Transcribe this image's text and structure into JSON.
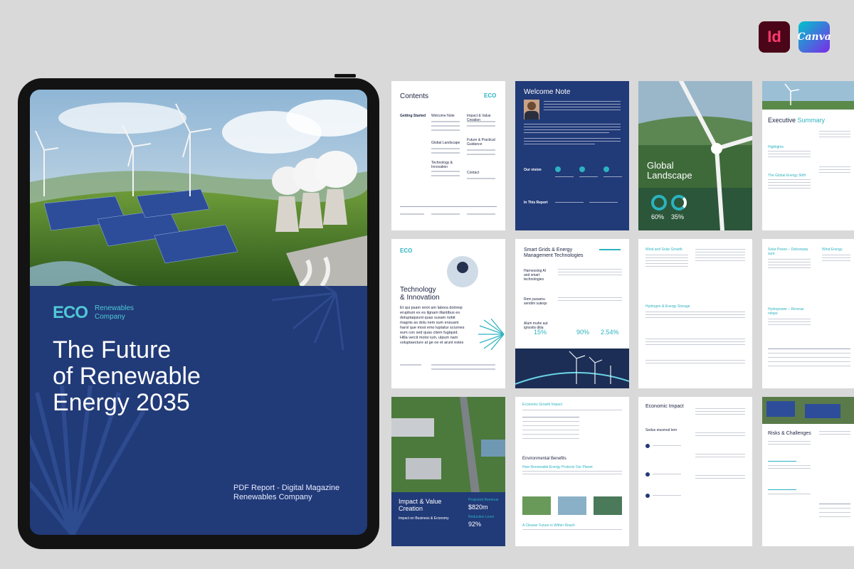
{
  "badges": {
    "indesign": "Id",
    "canva": "Canva"
  },
  "cover": {
    "logo_mark": "ECO",
    "logo_line1": "Renewables",
    "logo_line2": "Company",
    "title_line1": "The Future",
    "title_line2": "of Renewable",
    "title_line3": "Energy 2035",
    "subtitle_line1": "PDF Report - Digital Magazine",
    "subtitle_line2": "Renewables Company"
  },
  "pages": {
    "contents": {
      "title": "Contents",
      "logo": "ECO",
      "sections": [
        "Getting Started",
        "Welcome Note",
        "Global Landscape",
        "Technology & Innovation",
        "Impact & Value Creation",
        "Future & Practical Guidance",
        "Contact"
      ]
    },
    "welcome": {
      "title": "Welcome Note",
      "our_vision": "Our vision",
      "in_this_report": "In This Report"
    },
    "global": {
      "title_line1": "Global",
      "title_line2": "Landscape",
      "stat1": "60%",
      "stat2": "35%"
    },
    "executive": {
      "title": "Executive",
      "title_accent": "Summary",
      "highlights": "Highlights",
      "growth": "The Global Energy Shift"
    },
    "technology": {
      "logo": "ECO",
      "title_line1": "Technology",
      "title_line2": "& Innovation",
      "body": "Et qui psam rerot am labora dolorep eruptium ex es ilgnam illantibus es doluptaquiunt quas susam nobit magnis as dolu nem sum ensuant harol que most emo luptatur sciurnes eum con sed quas citem fugiquid. Hilla vercit molor ium, ulpum nam voluptaecture at ge oe et arunt estes"
    },
    "smartgrids": {
      "title_line1": "Smart Grids & Energy",
      "title_line2": "Management Technologies",
      "left1": "Harnessing AI and smart technologies",
      "left2": "Rem pusamu sendim suteqo",
      "left3": "Alum muhe aut ignostis ditia",
      "stat1": "15%",
      "stat2": "90%",
      "stat3": "2.54%"
    },
    "text_a": {
      "h1": "Wind and Solar Growth",
      "h2": "Hydrogen & Energy Storage"
    },
    "text_b": {
      "h1": "Solar Power – Deborepta sunt",
      "h2": "Hydropower – Rerorae nimpe",
      "h3": "Wind Energy"
    },
    "impact": {
      "title_line1": "Impact & Value",
      "title_line2": "Creation",
      "sub": "Impact on Business & Economy",
      "stat1_label": "Projected Revenue",
      "stat1": "$820m",
      "stat2_label": "Reduction Level",
      "stat2": "92%"
    },
    "environment": {
      "h1": "Economic Growth Impact",
      "h2": "Environmental Benefits",
      "h3": "How Renewable Energy Protects Our Planet",
      "h4": "A Cleaner Future is Within Reach"
    },
    "economic": {
      "title": "Economic Impact",
      "sub": "Sedus eiusmod tem"
    },
    "risks": {
      "title": "Risks & Challenges"
    }
  }
}
